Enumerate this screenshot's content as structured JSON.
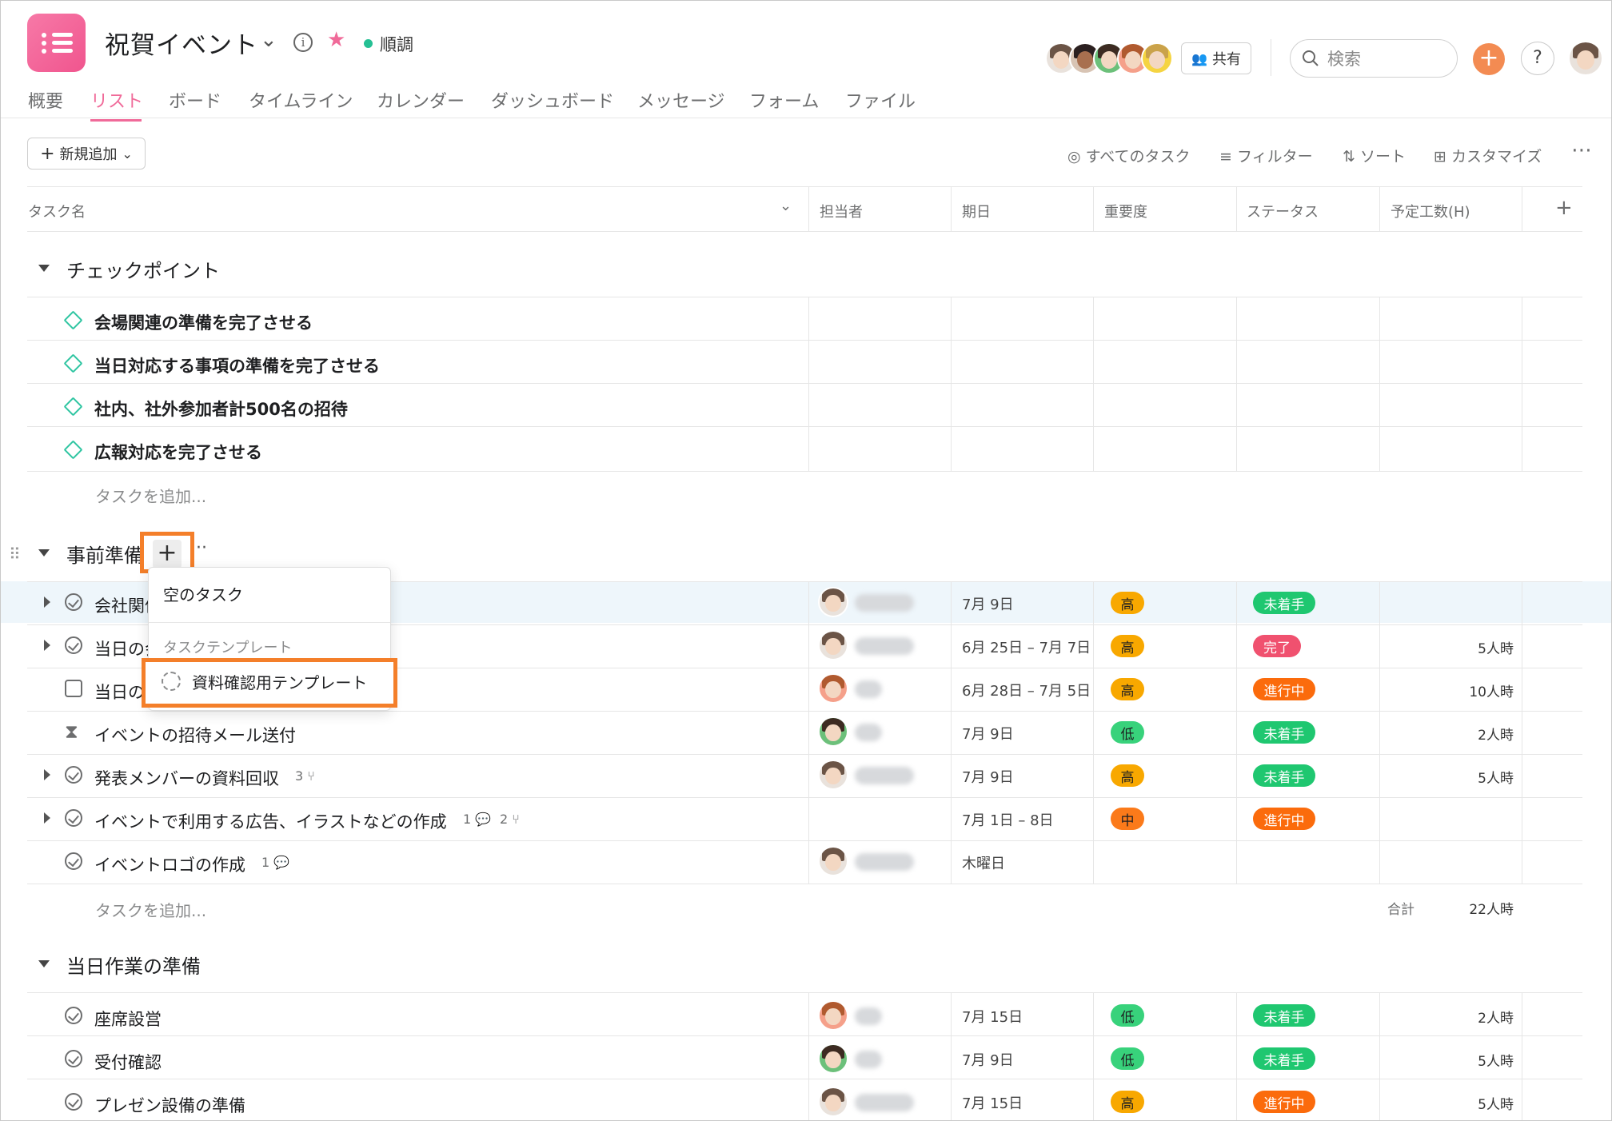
{
  "header": {
    "title": "祝賀イベント",
    "status_label": "順調",
    "share_label": "共有",
    "search_placeholder": "検索"
  },
  "tabs": [
    "概要",
    "リスト",
    "ボード",
    "タイムライン",
    "カレンダー",
    "ダッシュボード",
    "メッセージ",
    "フォーム",
    "ファイル"
  ],
  "active_tab": "リスト",
  "toolbar": {
    "new_label": "新規追加",
    "all_tasks": "すべてのタスク",
    "filter": "フィルター",
    "sort": "ソート",
    "customize": "カスタマイズ"
  },
  "columns": {
    "task": "タスク名",
    "assignee": "担当者",
    "due": "期日",
    "priority": "重要度",
    "status": "ステータス",
    "hours": "予定工数(H)"
  },
  "sections": {
    "checkpoint": {
      "title": "チェックポイント",
      "tasks": [
        "会場関連の準備を完了させる",
        "当日対応する事項の準備を完了させる",
        "社内、社外参加者計500名の招待",
        "広報対応を完了させる"
      ],
      "add_task": "タスクを追加..."
    },
    "prep": {
      "title": "事前準備",
      "tasks": [
        {
          "name": "会社関係",
          "due": "7月 9日",
          "priority": "高",
          "status": "未着手",
          "hours": ""
        },
        {
          "name": "当日の会",
          "due": "6月 25日 – 7月 7日",
          "priority": "高",
          "status": "完了",
          "hours": "5人時"
        },
        {
          "name": "当日の",
          "due": "6月 28日 – 7月 5日",
          "priority": "高",
          "status": "進行中",
          "hours": "10人時"
        },
        {
          "name": "イベントの招待メール送付",
          "due": "7月 9日",
          "priority": "低",
          "status": "未着手",
          "hours": "2人時"
        },
        {
          "name": "発表メンバーの資料回収",
          "subtasks": "3",
          "due": "7月 9日",
          "priority": "高",
          "status": "未着手",
          "hours": "5人時"
        },
        {
          "name": "イベントで利用する広告、イラストなどの作成",
          "comments": "1",
          "subtasks": "2",
          "due": "7月 1日 – 8日",
          "priority": "中",
          "status": "進行中",
          "hours": ""
        },
        {
          "name": "イベントロゴの作成",
          "comments": "1",
          "due": "木曜日",
          "priority": "",
          "status": "",
          "hours": ""
        }
      ],
      "add_task": "タスクを追加...",
      "total_label": "合計",
      "total_value": "22人時"
    },
    "dayof": {
      "title": "当日作業の準備",
      "tasks": [
        {
          "name": "座席設営",
          "due": "7月 15日",
          "priority": "低",
          "status": "未着手",
          "hours": "2人時"
        },
        {
          "name": "受付確認",
          "due": "7月 9日",
          "priority": "低",
          "status": "未着手",
          "hours": "5人時"
        },
        {
          "name": "プレゼン設備の準備",
          "due": "7月 15日",
          "priority": "高",
          "status": "進行中",
          "hours": "5人時"
        }
      ]
    }
  },
  "menu": {
    "empty_task": "空のタスク",
    "templates_header": "タスクテンプレート",
    "template_item": "資料確認用テンプレート"
  },
  "colors": {
    "accent": "#f06a99",
    "highlight_box": "#f47f2a",
    "priority_high": "#f8a800",
    "priority_low": "#38d27b",
    "priority_mid": "#fb7a1a",
    "status_todo": "#1fc770",
    "status_done": "#f0516f",
    "status_progress": "#fb6b0c"
  }
}
